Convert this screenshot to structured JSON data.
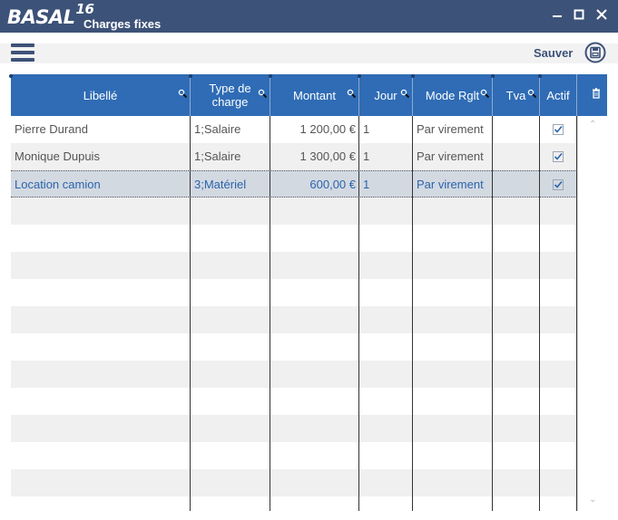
{
  "app": {
    "logo": "BASAL",
    "logo_version": "16",
    "window_title": "Charges fixes"
  },
  "window_controls": {
    "minimize": "—",
    "maximize": "□",
    "close": "✕"
  },
  "toolbar": {
    "menu_icon": "hamburger-menu-icon",
    "save_label": "Sauver",
    "save_icon": "save-disk-icon"
  },
  "colors": {
    "titlebar": "#3d5278",
    "header": "#2f6cb5",
    "selected_text": "#2a64ad",
    "selected_bg": "#d3d9e1"
  },
  "columns": [
    {
      "label": "Libellé",
      "searchable": true
    },
    {
      "label": "Type de charge",
      "searchable": true
    },
    {
      "label": "Montant",
      "searchable": true
    },
    {
      "label": "Jour",
      "searchable": true
    },
    {
      "label": "Mode Rglt",
      "searchable": true
    },
    {
      "label": "Tva",
      "searchable": true
    },
    {
      "label": "Actif",
      "searchable": false
    }
  ],
  "rows": [
    {
      "libelle": "Pierre Durand",
      "type": "1;Salaire",
      "montant": "1 200,00 €",
      "jour": "1",
      "mode": "Par virement",
      "tva": "",
      "actif": true,
      "selected": false
    },
    {
      "libelle": "Monique Dupuis",
      "type": "1;Salaire",
      "montant": "1 300,00 €",
      "jour": "1",
      "mode": "Par virement",
      "tva": "",
      "actif": true,
      "selected": false
    },
    {
      "libelle": "Location camion",
      "type": "3;Matériel",
      "montant": "600,00 €",
      "jour": "1",
      "mode": "Par virement",
      "tva": "",
      "actif": true,
      "selected": true
    }
  ],
  "empty_rows": 11
}
